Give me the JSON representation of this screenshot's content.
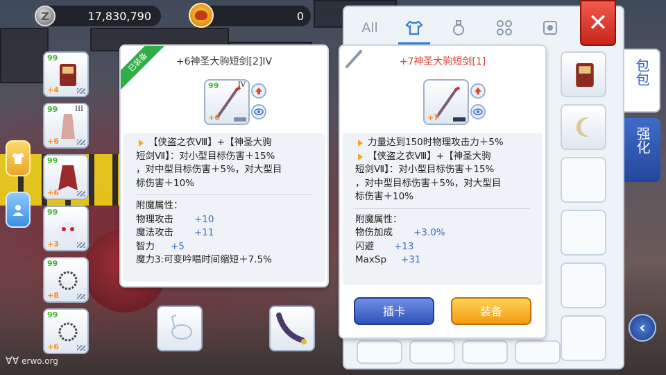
{
  "hud": {
    "zeny_value": "17,830,790",
    "zeny_glyph": "Z",
    "secondary_value": "0"
  },
  "left_bar": {
    "slots": [
      {
        "level": "99",
        "refine": "+4"
      },
      {
        "level": "99",
        "refine": "+6",
        "roman": "III"
      },
      {
        "level": "99",
        "refine": "+6"
      },
      {
        "level": "99",
        "refine": "+3"
      },
      {
        "level": "99",
        "refine": "+8"
      },
      {
        "level": "99",
        "refine": "+6"
      }
    ]
  },
  "equipped_card": {
    "badge": "已装备",
    "title": "+6神圣大驹短剑[2]IV",
    "item_level": "99",
    "item_refine": "+6",
    "item_roman": "IV",
    "combo_line_1": "【侠盗之衣Ⅷ】+【神圣大驹",
    "combo_line_2": "短剑Ⅶ】：对小型目标伤害＋15%",
    "combo_line_3": "，对中型目标伤害＋5%，对大型目",
    "combo_line_4": "标伤害＋10%",
    "enchant_title": "附魔属性：",
    "stats": [
      {
        "name": "物理攻击",
        "value": "+10"
      },
      {
        "name": "魔法攻击",
        "value": "+11"
      },
      {
        "name": "智力",
        "value": "+5"
      }
    ],
    "special": "魔力3:可变吟唱时间缩短＋7.5%"
  },
  "compare_card": {
    "title": "+7神圣大驹短剑[1]",
    "item_refine": "+7",
    "bonus_line": "力量达到150时物理攻击力＋5%",
    "combo_line_1": "【侠盗之衣Ⅷ】+【神圣大驹",
    "combo_line_2": "短剑Ⅶ】：对小型目标伤害＋15%",
    "combo_line_3": "，对中型目标伤害＋5%，对大型目",
    "combo_line_4": "标伤害＋10%",
    "enchant_title": "附魔属性：",
    "stats": [
      {
        "name": "物伤加成",
        "value": "+3.0%"
      },
      {
        "name": "闪避",
        "value": "+13"
      },
      {
        "name": "MaxSp",
        "value": "+31"
      }
    ],
    "btn_card": "插卡",
    "btn_equip": "装备"
  },
  "inventory": {
    "tab_all": "All",
    "side_tab_bag": "包包",
    "side_tab_enhance": "强化",
    "close_glyph": "✕",
    "back_glyph": "‹"
  },
  "watermark": {
    "logo": "ⱯⱯ",
    "text": "erwo.org"
  },
  "colors": {
    "accent_blue": "#2f7cd6",
    "equip_orange": "#f39b0f",
    "close_red": "#c8261b",
    "stat_blue": "#3a6fc4",
    "refine_orange": "#ff8a1e",
    "level_green": "#3fb32d"
  }
}
